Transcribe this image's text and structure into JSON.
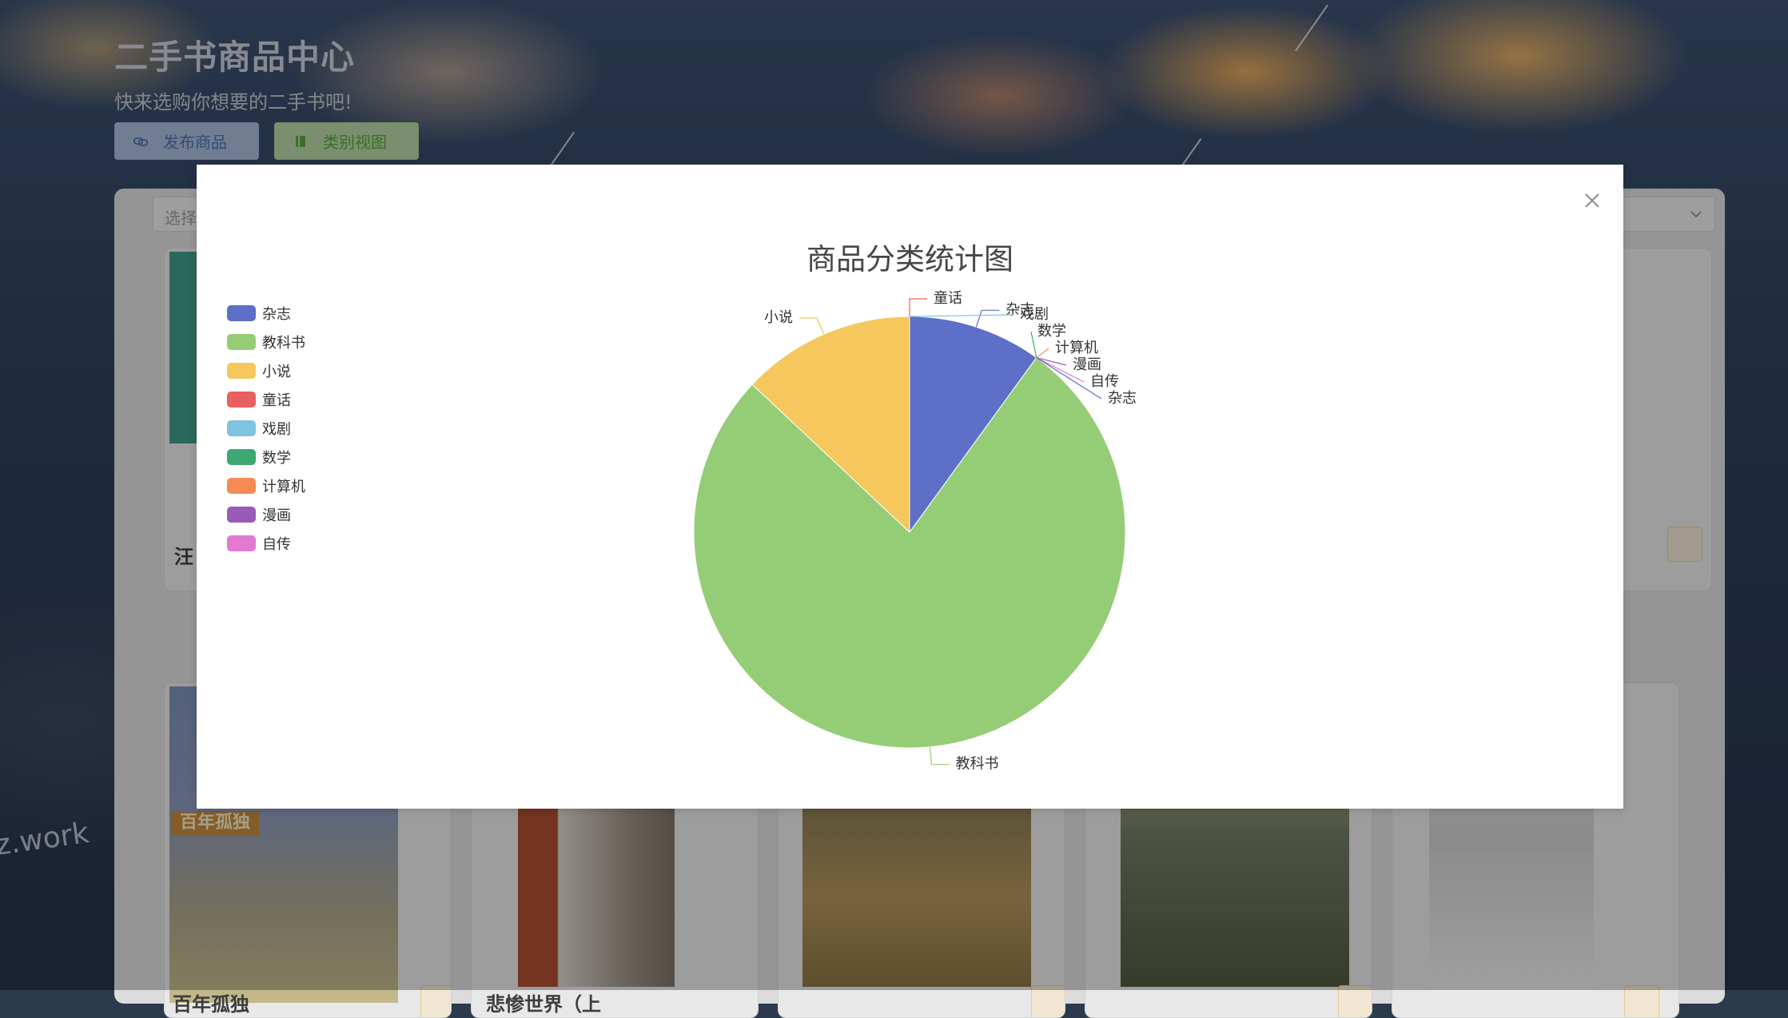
{
  "header": {
    "title": "二手书商品中心",
    "subtitle": "快来选购你想要的二手书吧!",
    "publish_label": "发布商品",
    "category_label": "类别视图",
    "publish_color": "#4b6fb0",
    "category_color": "#55a43a"
  },
  "background": {
    "watermark_text": "z.work"
  },
  "filter": {
    "placeholder": "选择"
  },
  "cards": {
    "top_left_title": "汪",
    "bottom": [
      {
        "title": "百年孤独",
        "cover_text": "百年孤独"
      },
      {
        "title": "悲惨世界（上"
      },
      {
        "title": ""
      },
      {
        "title": ""
      },
      {
        "title": ""
      }
    ]
  },
  "dialog": {
    "close_icon": "close-icon"
  },
  "chart_data": {
    "type": "pie",
    "title": "商品分类统计图",
    "categories": [
      "杂志",
      "教科书",
      "小说",
      "童话",
      "戏剧",
      "数学",
      "计算机",
      "漫画",
      "自传"
    ],
    "values": [
      10,
      77,
      13,
      0,
      0,
      0,
      0,
      0,
      0
    ],
    "colors": [
      "#5d6fc6",
      "#94cd76",
      "#f5c75c",
      "#e8605e",
      "#7ec3e0",
      "#3ea872",
      "#f68a55",
      "#9a5bb8",
      "#e27ad0"
    ],
    "legend_position": "left"
  }
}
